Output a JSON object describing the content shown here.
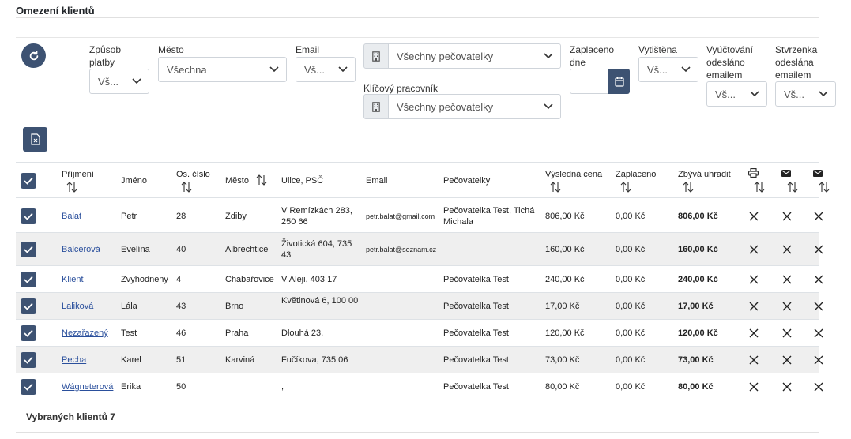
{
  "page": {
    "title": "Omezení klientů"
  },
  "filters": {
    "platba": {
      "label": "Způsob platby",
      "value": "Vš..."
    },
    "mesto": {
      "label": "Město",
      "value": "Všechna"
    },
    "email": {
      "label": "Email",
      "value": "Vš..."
    },
    "pecovatelky": {
      "value": "Všechny pečovatelky"
    },
    "klicovy": {
      "label": "Klíčový pracovník",
      "value": "Všechny pečovatelky"
    },
    "zaplaceno": {
      "label": "Zaplaceno dne",
      "value": ""
    },
    "vytistena": {
      "label": "Vytištěna",
      "value": "Vš..."
    },
    "vyuctovani": {
      "label": "Vyúčtování odesláno emailem",
      "value": "Vš..."
    },
    "stvrzenka": {
      "label": "Stvrzenka odeslána emailem",
      "value": "Vš..."
    }
  },
  "icons": {
    "refresh": "refresh-icon",
    "export": "excel-export-icon",
    "building": "building-icon",
    "calendar": "calendar-icon",
    "print": "printer-icon",
    "mail": "envelope-icon",
    "remove": "close-icon"
  },
  "colors": {
    "accent": "#3d5272",
    "link": "#2a4f9c"
  },
  "table": {
    "headers": {
      "prijmeni": "Příjmení",
      "jmeno": "Jméno",
      "cislo": "Os. číslo",
      "mesto": "Město",
      "ulice": "Ulice, PSČ",
      "email": "Email",
      "pecovatelky": "Pečovatelky",
      "cena": "Výsledná cena",
      "zaplaceno": "Zaplaceno",
      "zbyva": "Zbývá uhradit"
    },
    "rows": [
      {
        "prijmeni": "Balat",
        "jmeno": "Petr",
        "cislo": "28",
        "mesto": "Zdiby",
        "ulice": "V Remízkách 283, 250 66",
        "email": "petr.balat@gmail.com",
        "pecovatelky": "Pečovatelka Test, Tichá Michala",
        "cena": "806,00 Kč",
        "zaplaceno": "0,00 Kč",
        "zbyva": "806,00 Kč",
        "checked": true
      },
      {
        "prijmeni": "Balcerová",
        "jmeno": "Evelína",
        "cislo": "40",
        "mesto": "Albrechtice",
        "ulice": "Životická 604, 735 43",
        "email": "petr.balat@seznam.cz",
        "pecovatelky": "",
        "cena": "160,00 Kč",
        "zaplaceno": "0,00 Kč",
        "zbyva": "160,00 Kč",
        "checked": true
      },
      {
        "prijmeni": "Klient",
        "jmeno": "Zvyhodneny",
        "cislo": "4",
        "mesto": "Chabařovice",
        "ulice": "V Aleji, 403 17",
        "email": "",
        "pecovatelky": "Pečovatelka Test",
        "cena": "240,00 Kč",
        "zaplaceno": "0,00 Kč",
        "zbyva": "240,00 Kč",
        "checked": true
      },
      {
        "prijmeni": "Laliková",
        "jmeno": "Lála",
        "cislo": "43",
        "mesto": "Brno",
        "ulice": "Květinová 6, 100 00",
        "email": "",
        "pecovatelky": "Pečovatelka Test",
        "cena": "17,00 Kč",
        "zaplaceno": "0,00 Kč",
        "zbyva": "17,00 Kč",
        "checked": true
      },
      {
        "prijmeni": "Nezařazený",
        "jmeno": "Test",
        "cislo": "46",
        "mesto": "Praha",
        "ulice": "Dlouhá 23,",
        "email": "",
        "pecovatelky": "Pečovatelka Test",
        "cena": "120,00 Kč",
        "zaplaceno": "0,00 Kč",
        "zbyva": "120,00 Kč",
        "checked": true
      },
      {
        "prijmeni": "Pecha",
        "jmeno": "Karel",
        "cislo": "51",
        "mesto": "Karviná",
        "ulice": "Fučíkova, 735 06",
        "email": "",
        "pecovatelky": "Pečovatelka Test",
        "cena": "73,00 Kč",
        "zaplaceno": "0,00 Kč",
        "zbyva": "73,00 Kč",
        "checked": true
      },
      {
        "prijmeni": "Wágneterová",
        "jmeno": "Erika",
        "cislo": "50",
        "mesto": "",
        "ulice": ",",
        "email": "",
        "pecovatelky": "Pečovatelka Test",
        "cena": "80,00 Kč",
        "zaplaceno": "0,00 Kč",
        "zbyva": "80,00 Kč",
        "checked": true
      }
    ]
  },
  "footer": {
    "selected": "Vybraných klientů 7"
  }
}
